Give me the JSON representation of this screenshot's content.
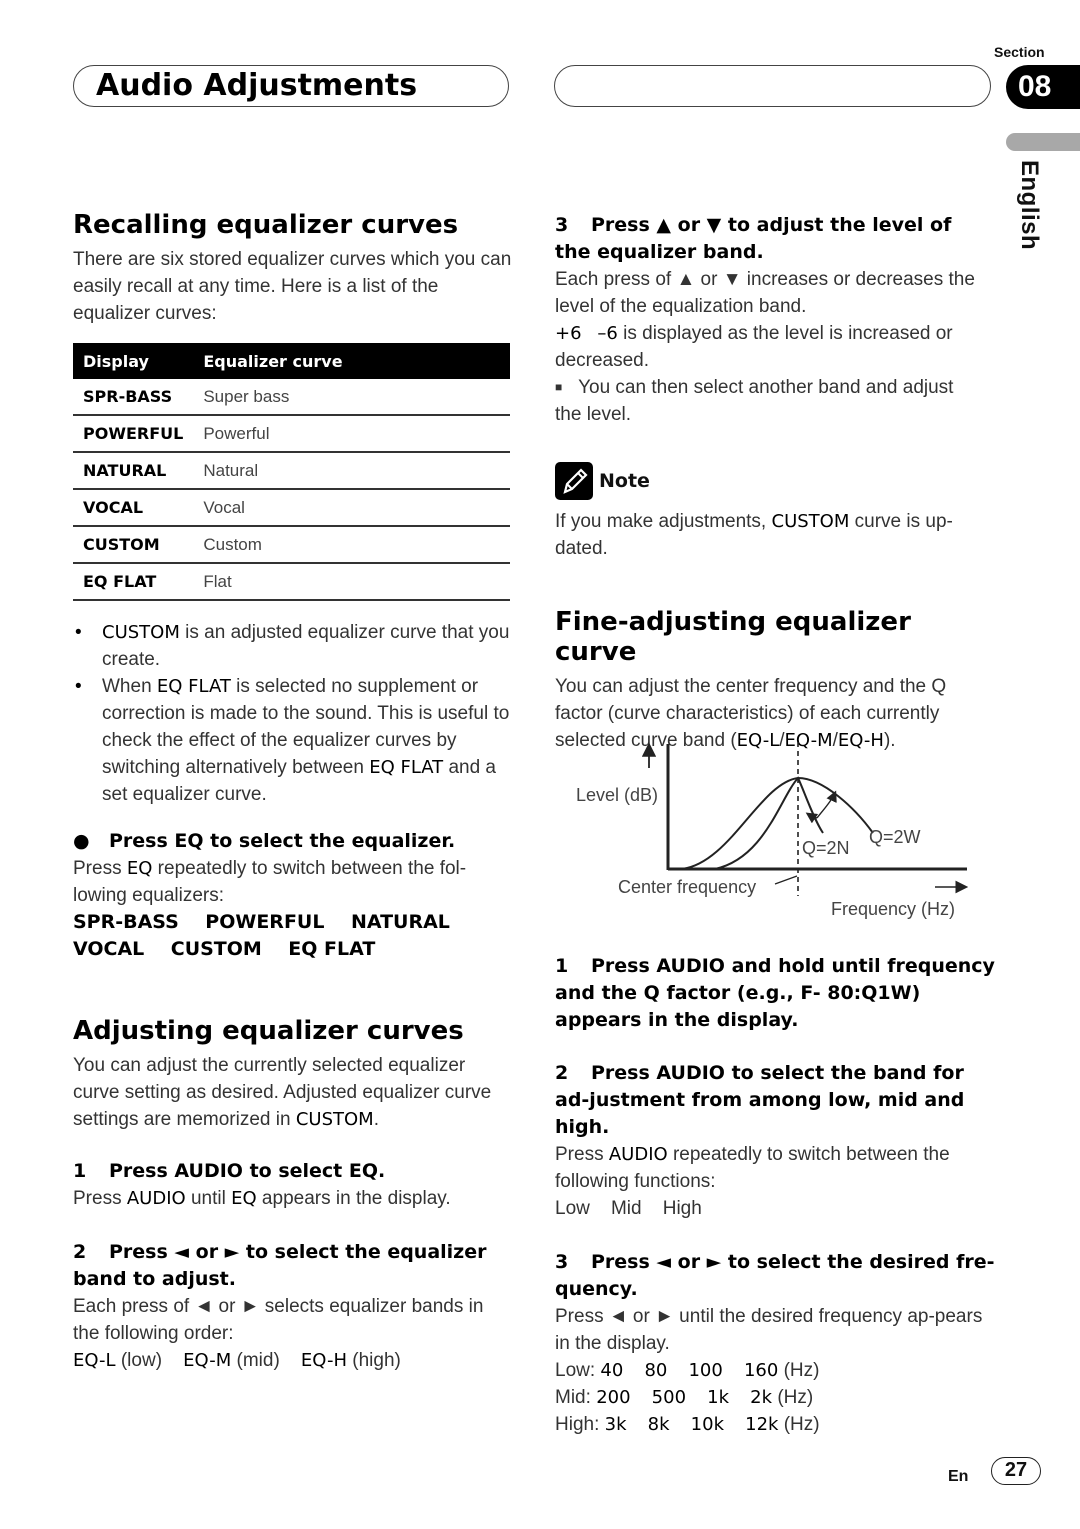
{
  "header": {
    "title": "Audio Adjustments",
    "section_label": "Section",
    "section_number": "08",
    "language": "English"
  },
  "recall": {
    "heading": "Recalling equalizer curves",
    "intro": "There are six stored equalizer curves which you can easily recall at any time. Here is a list of the equalizer curves:",
    "table": {
      "headers": [
        "Display",
        "Equalizer curve"
      ],
      "rows": [
        {
          "display": "SPR-BASS",
          "curve": "Super bass"
        },
        {
          "display": "POWERFUL",
          "curve": "Powerful"
        },
        {
          "display": "NATURAL",
          "curve": "Natural"
        },
        {
          "display": "VOCAL",
          "curve": "Vocal"
        },
        {
          "display": "CUSTOM",
          "curve": "Custom"
        },
        {
          "display": "EQ FLAT",
          "curve": "Flat"
        }
      ]
    },
    "bullets": [
      {
        "kw": "CUSTOM",
        "text": " is an adjusted equalizer curve that you create."
      },
      {
        "pre": "When ",
        "kw": "EQ FLAT",
        "text": " is selected no supplement or correction is made to the sound. This is useful to check the effect of the equalizer curves by switching alternatively between ",
        "kw2": "EQ FLAT",
        "text2": " and a set equalizer curve."
      }
    ],
    "step": {
      "label": "Press EQ to select the equalizer.",
      "body_pre": "Press ",
      "body_kw": "EQ",
      "body_post": " repeatedly to switch between the fol-lowing equalizers:",
      "line1": [
        "SPR-BASS",
        "POWERFUL",
        "NATURAL"
      ],
      "line2": [
        "VOCAL",
        "CUSTOM",
        "EQ FLAT"
      ]
    }
  },
  "adjust": {
    "heading": "Adjusting equalizer curves",
    "intro_pre": "You can adjust the currently selected equalizer curve setting as desired. Adjusted equalizer curve settings are memorized in ",
    "intro_kw": "CUSTOM",
    "intro_post": ".",
    "step1": {
      "num": "1",
      "label": "Press AUDIO to select EQ.",
      "body": [
        {
          "t": "Press "
        },
        {
          "b": "AUDIO"
        },
        {
          "t": " until "
        },
        {
          "b": "EQ"
        },
        {
          "t": " appears in the display."
        }
      ]
    },
    "step2": {
      "num": "2",
      "label": "Press ◄ or ► to select the equalizer band to adjust.",
      "body": "Each press of ◄ or ► selects equalizer bands in the following order:",
      "order": [
        {
          "kw": "EQ-L",
          "desc": "(low)"
        },
        {
          "kw": "EQ-M",
          "desc": "(mid)"
        },
        {
          "kw": "EQ-H",
          "desc": "(high)"
        }
      ]
    },
    "step3": {
      "num": "3",
      "label": "Press ▲ or ▼ to adjust the level of the equalizer band.",
      "body": "Each press of ▲ or ▼ increases or decreases the level of the equalization band.",
      "range_hi": "+6",
      "range_lo": "–6",
      "range_text": " is displayed as the level is increased or decreased.",
      "end_note": "You can then select another band and adjust the level."
    },
    "note": {
      "label": "Note",
      "pre": "If you make adjustments, ",
      "kw": "CUSTOM",
      "post": " curve is up-dated."
    }
  },
  "fine": {
    "heading": "Fine-adjusting equalizer curve",
    "intro_pre": "You can adjust the center frequency and the Q factor (curve characteristics) of each currently selected curve band (",
    "intro_bands": [
      "EQ-L",
      "EQ-M",
      "EQ-H"
    ],
    "intro_post": ").",
    "diagram": {
      "y_label": "Level (dB)",
      "x_label": "Frequency (Hz)",
      "center_label": "Center frequency",
      "narrow_label": "Q=2N",
      "wide_label": "Q=2W"
    },
    "step1": {
      "num": "1",
      "label": "Press AUDIO and hold until frequency and the Q factor (e.g., F- 80:Q1W) appears in the display."
    },
    "step2": {
      "num": "2",
      "label": "Press AUDIO to select the band for ad-justment from among low, mid and high.",
      "body_pre": "Press ",
      "body_kw": "AUDIO",
      "body_post": " repeatedly to switch between the following functions:",
      "functions": [
        "Low",
        "Mid",
        "High"
      ]
    },
    "step3": {
      "num": "3",
      "label": "Press ◄ or ► to select the desired fre-quency.",
      "body": "Press ◄ or ► until the desired frequency ap-pears in the display.",
      "bands": [
        {
          "name": "Low:",
          "values": [
            "40",
            "80",
            "100",
            "160"
          ],
          "unit": "(Hz)"
        },
        {
          "name": "Mid:",
          "values": [
            "200",
            "500",
            "1k",
            "2k"
          ],
          "unit": "(Hz)"
        },
        {
          "name": "High:",
          "values": [
            "3k",
            "8k",
            "10k",
            "12k"
          ],
          "unit": "(Hz)"
        }
      ]
    }
  },
  "footer": {
    "lang_code": "En",
    "page": "27"
  }
}
